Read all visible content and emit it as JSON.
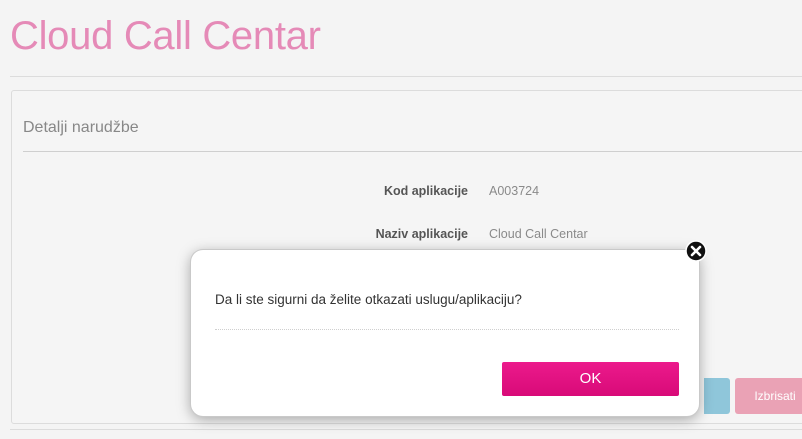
{
  "page": {
    "title": "Cloud Call Centar"
  },
  "panel": {
    "heading": "Detalji narudžbe",
    "details": [
      {
        "label": "Kod aplikacije",
        "value": "A003724"
      },
      {
        "label": "Naziv aplikacije",
        "value": "Cloud Call Centar"
      }
    ],
    "delete_label": "Izbrisati"
  },
  "modal": {
    "message": "Da li ste sigurni da želite otkazati uslugu/aplikaciju?",
    "ok_label": "OK",
    "close_icon": "close-icon"
  },
  "colors": {
    "brand_pink": "#e20074",
    "title_pink": "#e58ab7",
    "delete_button": "#eaa2b5",
    "secondary_button": "#8fc6da"
  }
}
